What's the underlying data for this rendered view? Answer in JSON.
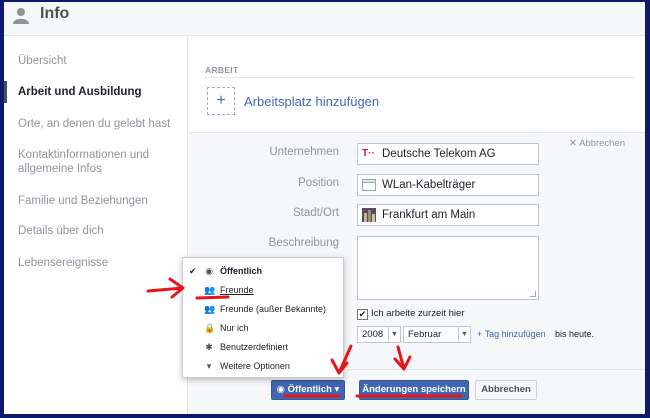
{
  "header": {
    "title": "Info"
  },
  "sidebar": {
    "items": [
      {
        "label": "Übersicht"
      },
      {
        "label": "Arbeit und Ausbildung"
      },
      {
        "label": "Orte, an denen du gelebt hast"
      },
      {
        "label": "Kontaktinformationen und allgemeine Infos"
      },
      {
        "label": "Familie und Beziehungen"
      },
      {
        "label": "Details über dich"
      },
      {
        "label": "Lebensereignisse"
      }
    ],
    "active_index": 1
  },
  "work": {
    "section_label": "ARBEIT",
    "add_label": "Arbeitsplatz hinzufügen",
    "cancel_label": "Abbrechen",
    "fields": {
      "company": {
        "label": "Unternehmen",
        "value": "Deutsche Telekom AG",
        "icon": "telekom-logo-icon"
      },
      "position": {
        "label": "Position",
        "value": "WLan-Kabelträger",
        "icon": "position-icon"
      },
      "city": {
        "label": "Stadt/Ort",
        "value": "Frankfurt am Main",
        "icon": "city-photo-icon"
      },
      "description": {
        "label": "Beschreibung",
        "value": ""
      }
    },
    "currently_working": {
      "label": "Ich arbeite zurzeit hier",
      "checked": true
    },
    "period": {
      "year": "2008",
      "month": "Februar",
      "tag_link": "+ Tag hinzufügen",
      "until": "bis heute."
    }
  },
  "privacy_menu": {
    "items": [
      {
        "label": "Öffentlich",
        "icon": "globe-icon",
        "checked": true
      },
      {
        "label": "Freunde",
        "icon": "friends-icon",
        "checked": false
      },
      {
        "label": "Freunde (außer Bekannte)",
        "icon": "friends-except-icon",
        "checked": false
      },
      {
        "label": "Nur ich",
        "icon": "lock-icon",
        "checked": false
      },
      {
        "label": "Benutzerdefiniert",
        "icon": "gear-icon",
        "checked": false
      },
      {
        "label": "Weitere Optionen",
        "icon": "triangle-down-icon",
        "checked": false
      }
    ]
  },
  "buttons": {
    "privacy": "Öffentlich",
    "save": "Änderungen speichern",
    "cancel": "Abbrechen"
  },
  "colors": {
    "accent": "#4267b2",
    "annotation": "#e8141b",
    "border_frame": "#0b1a6b"
  }
}
